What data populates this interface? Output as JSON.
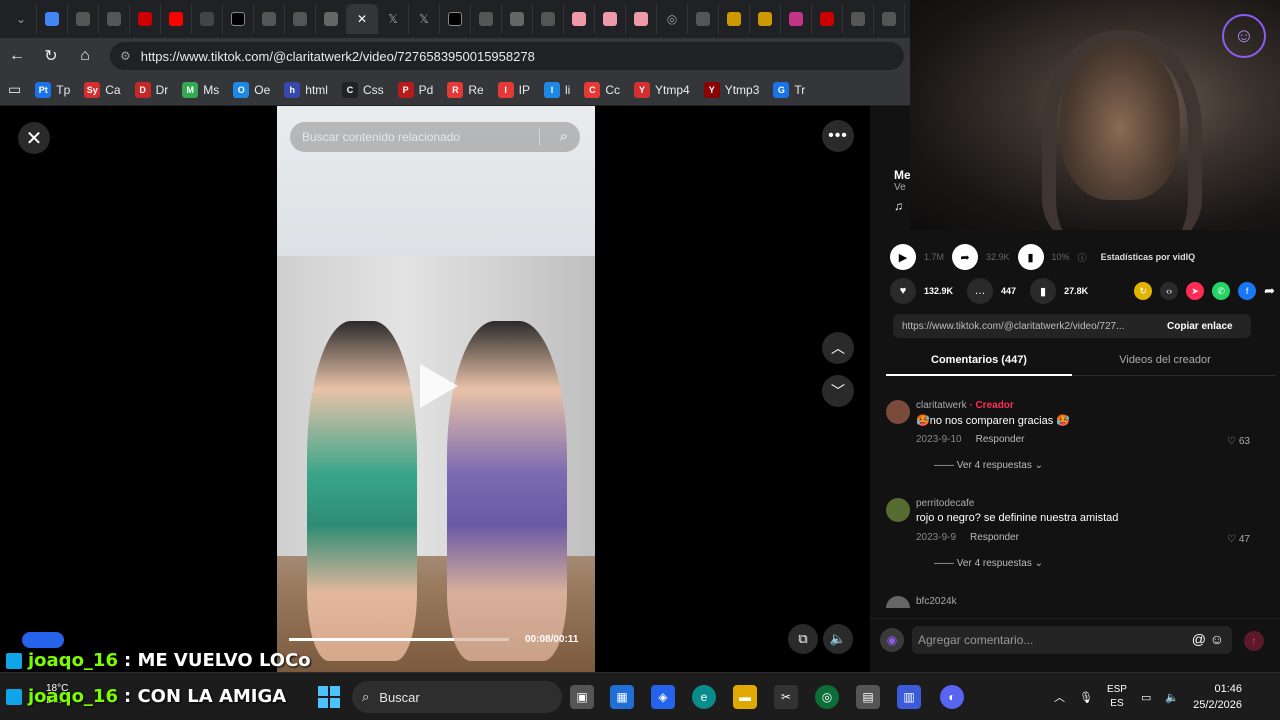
{
  "browser": {
    "url": "https://www.tiktok.com/@claritatwerk2/video/7276583950015958278",
    "bookmarks": [
      {
        "label": "Tp",
        "color": "#1a73e8",
        "badge": "Pt"
      },
      {
        "label": "Ca",
        "color": "#d32f2f",
        "badge": "Sy"
      },
      {
        "label": "Dr",
        "color": "#c62828",
        "badge": "D"
      },
      {
        "label": "Ms",
        "color": "#34a853",
        "badge": "M"
      },
      {
        "label": "Oe",
        "color": "#1e88e5",
        "badge": "O"
      },
      {
        "label": "html",
        "color": "#3949ab",
        "badge": "h"
      },
      {
        "label": "Css",
        "color": "#222222",
        "badge": "C"
      },
      {
        "label": "Pd",
        "color": "#b71c1c",
        "badge": "P"
      },
      {
        "label": "Re",
        "color": "#e53935",
        "badge": "R"
      },
      {
        "label": "IP",
        "color": "#e53935",
        "badge": "I"
      },
      {
        "label": "li",
        "color": "#1e88e5",
        "badge": "l"
      },
      {
        "label": "Cc",
        "color": "#e53935",
        "badge": "C"
      },
      {
        "label": "Ytmp4",
        "color": "#d32f2f",
        "badge": "Y"
      },
      {
        "label": "Ytmp3",
        "color": "#8b0000",
        "badge": "Y"
      },
      {
        "label": "Tr",
        "color": "#1a73e8",
        "badge": "G"
      }
    ]
  },
  "video": {
    "search_placeholder": "Buscar contenido relacionado",
    "time": "00:08/00:11",
    "progress": 0.75
  },
  "side": {
    "author_initial": "Me",
    "author_sub": "Ve",
    "stats_label": "Estadísticas por vidIQ",
    "plays": "1.7M",
    "shares_top": "32.9K",
    "pct": "10%",
    "likes": "132.9K",
    "comments": "447",
    "saves": "27.8K",
    "link": "https://www.tiktok.com/@claritatwerk2/video/727...",
    "copy_label": "Copiar enlace",
    "tab_comments": "Comentarios (447)",
    "tab_creator": "Videos del creador",
    "comment_placeholder": "Agregar comentario...",
    "comments_list": [
      {
        "user": "claritatwerk",
        "creator_tag": " · Creador",
        "text": "🥵no nos comparen gracias 🥵",
        "date": "2023-9-10",
        "reply": "Responder",
        "likes": "63",
        "more": "Ver 4 respuestas",
        "avatar": "#7a4a3a"
      },
      {
        "user": "perritodecafe",
        "creator_tag": "",
        "text": "rojo o negro? se definine nuestra amistad",
        "date": "2023-9-9",
        "reply": "Responder",
        "likes": "47",
        "more": "Ver 4 respuestas",
        "avatar": "#556b2f"
      },
      {
        "user": "bfc2024k",
        "creator_tag": "",
        "text": "",
        "date": "",
        "reply": "",
        "likes": "",
        "more": "",
        "avatar": "#666666"
      }
    ]
  },
  "chat": [
    {
      "user": "joaqo_16",
      "text": ": ME VUELVO LOCo"
    },
    {
      "user": "joaqo_16",
      "text": ": CON LA AMIGA"
    }
  ],
  "taskbar": {
    "temp": "18°C",
    "weather_sub": "D...",
    "search": "Buscar",
    "lang1": "ESP",
    "lang2": "ES",
    "time": "01:46",
    "date": "25/2/2026"
  }
}
